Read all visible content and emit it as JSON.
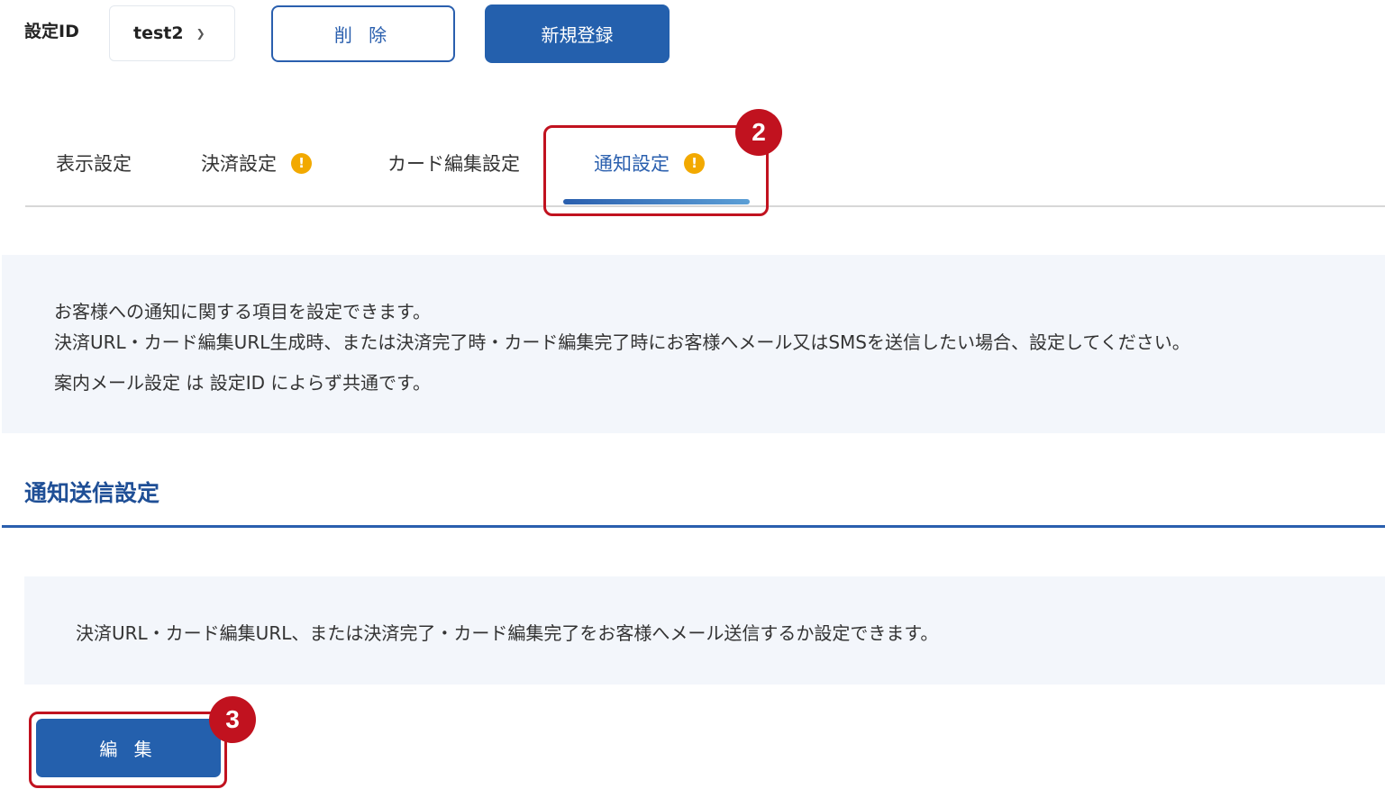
{
  "toolbar": {
    "setting_id_label": "設定ID",
    "setting_id_value": "test2",
    "delete_label": "削 除",
    "new_label": "新規登録"
  },
  "tabs": [
    {
      "label": "表示設定",
      "warning": false,
      "active": false
    },
    {
      "label": "決済設定",
      "warning": true,
      "active": false
    },
    {
      "label": "カード編集設定",
      "warning": false,
      "active": false
    },
    {
      "label": "通知設定",
      "warning": true,
      "active": true
    }
  ],
  "info": {
    "lines": [
      "お客様への通知に関する項目を設定できます。",
      "決済URL・カード編集URL生成時、または決済完了時・カード編集完了時にお客様へメール又はSMSを送信したい場合、設定してください。",
      "案内メール設定 は 設定ID によらず共通です。"
    ]
  },
  "section": {
    "title": "通知送信設定",
    "description": "決済URL・カード編集URL、または決済完了・カード編集完了をお客様へメール送信するか設定できます。",
    "edit_label": "編 集"
  },
  "annotations": {
    "tab_marker": "2",
    "edit_marker": "3"
  },
  "colors": {
    "primary": "#2460ad",
    "highlight": "#c1121f",
    "warning": "#f2a900",
    "panel": "#f3f6fb"
  }
}
